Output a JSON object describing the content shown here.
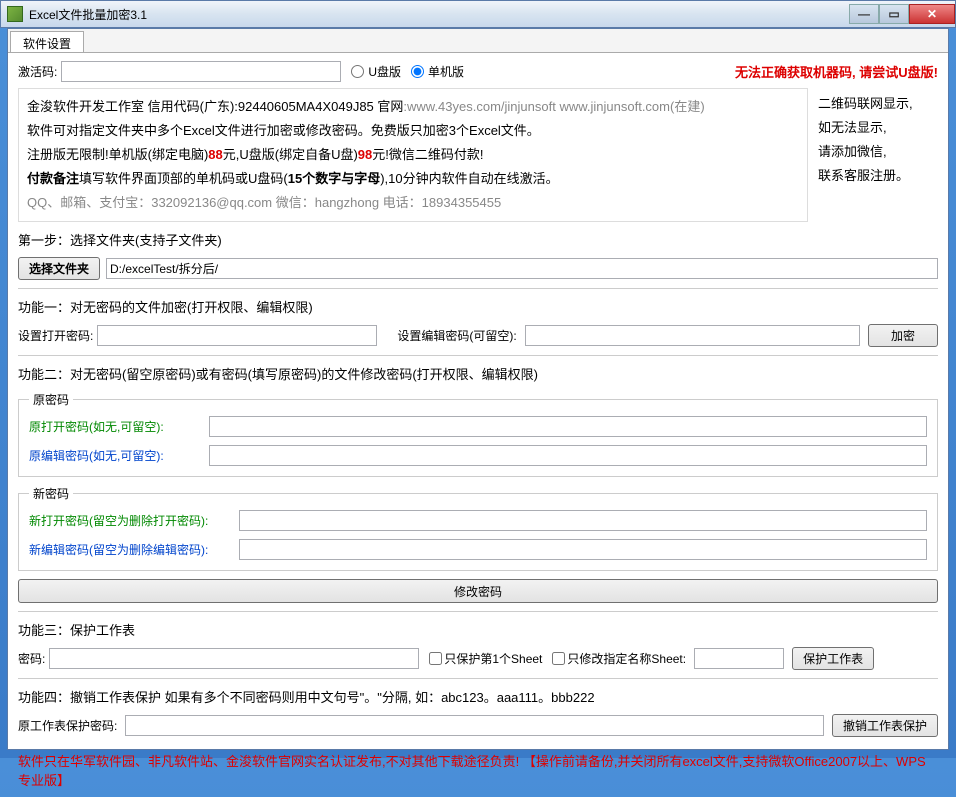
{
  "window": {
    "title": "Excel文件批量加密3.1"
  },
  "tabs": {
    "settings": "软件设置"
  },
  "activation": {
    "label": "激活码:",
    "usb_label": "U盘版",
    "standalone_label": "单机版",
    "error": "无法正确获取机器码, 请尝试U盘版!"
  },
  "info": {
    "line1a": "金浚软件开发工作室 信用代码(广东):92440605MA4X049J85 官网",
    "line1b": ":www.43yes.com/jinjunsoft   www.jinjunsoft.com(在建)",
    "line2": "软件可对指定文件夹中多个Excel文件进行加密或修改密码。免费版只加密3个Excel文件。",
    "line3a": "注册版无限制!单机版(绑定电脑)",
    "line3b": "88",
    "line3c": "元,U盘版(绑定自备U盘)",
    "line3d": "98",
    "line3e": "元!微信二维码付款!",
    "line4a": "付款备注",
    "line4b": "填写软件界面顶部的单机码或U盘码(",
    "line4c": "15个数字与字母",
    "line4d": "),10分钟内软件自动在线激活。",
    "line5": "QQ、邮箱、支付宝：332092136@qq.com   微信：hangzhong    电话：18934355455"
  },
  "qr": {
    "l1": "二维码联网显示,",
    "l2": "如无法显示,",
    "l3": "请添加微信,",
    "l4": "联系客服注册。"
  },
  "step1": {
    "title": "第一步：选择文件夹(支持子文件夹)",
    "btn": "选择文件夹",
    "path": "D:/excelTest/拆分后/"
  },
  "func1": {
    "title": "功能一：对无密码的文件加密(打开权限、编辑权限)",
    "open_pw": "设置打开密码:",
    "edit_pw": "设置编辑密码(可留空):",
    "btn": "加密"
  },
  "func2": {
    "title": "功能二：对无密码(留空原密码)或有密码(填写原密码)的文件修改密码(打开权限、编辑权限)",
    "old_legend": "原密码",
    "old_open": "原打开密码(如无,可留空):",
    "old_edit": "原编辑密码(如无,可留空):",
    "new_legend": "新密码",
    "new_open": "新打开密码(留空为删除打开密码):",
    "new_edit": "新编辑密码(留空为删除编辑密码):",
    "btn": "修改密码"
  },
  "func3": {
    "title": "功能三：保护工作表",
    "pw": "密码:",
    "only_first": "只保护第1个Sheet",
    "only_named": "只修改指定名称Sheet:",
    "btn": "保护工作表"
  },
  "func4": {
    "title": "功能四：撤销工作表保护   如果有多个不同密码则用中文句号\"。\"分隔, 如：abc123。aaa111。bbb222",
    "pw": "原工作表保护密码:",
    "btn": "撤销工作表保护"
  },
  "footer": "软件只在华军软件园、非凡软件站、金浚软件官网实名认证发布,不对其他下载途径负责!  【操作前请备份,并关闭所有excel文件,支持微软Office2007以上、WPS专业版】"
}
